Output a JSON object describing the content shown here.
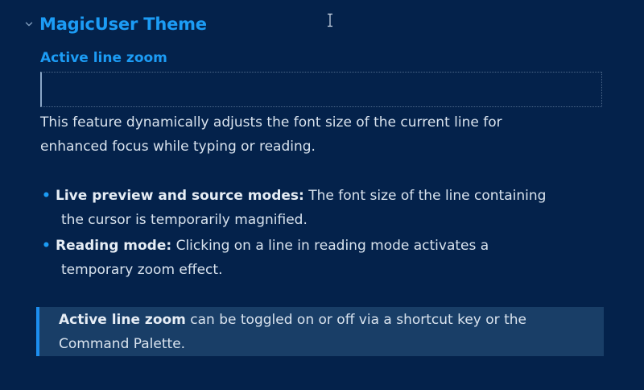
{
  "heading": {
    "title": "MagicUser Theme",
    "chevron_icon": "chevron-down-icon"
  },
  "section": {
    "subtitle": "Active line zoom"
  },
  "description": {
    "line1": "This feature dynamically adjusts the font size of the current line for",
    "line2": "enhanced focus while typing or reading."
  },
  "bullets": [
    {
      "term": "Live preview and source modes:",
      "text1": "The font size of the line containing",
      "text2": "the cursor is temporarily magnified."
    },
    {
      "term": "Reading mode:",
      "text1": "Clicking on a line in reading mode activates a",
      "text2": "temporary zoom effect."
    }
  ],
  "callout": {
    "term": "Active line zoom",
    "text1": "can be toggled on or off via a shortcut key or the",
    "text2": "Command Palette."
  },
  "colors": {
    "background": "#04224b",
    "accent": "#1c9cf5",
    "callout_bg": "#193e67",
    "text": "#d9e3ee"
  }
}
